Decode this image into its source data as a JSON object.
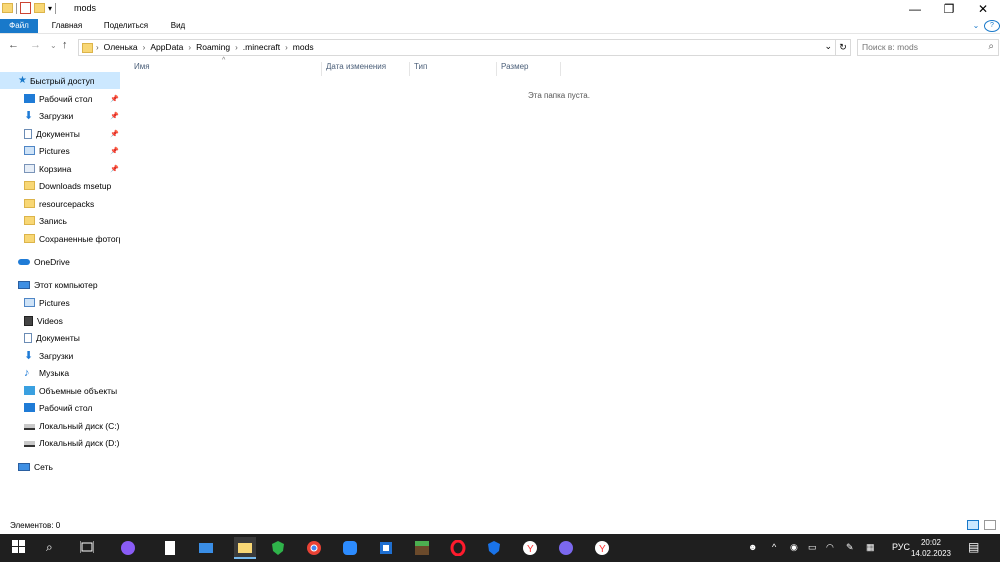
{
  "window": {
    "title": "mods",
    "controls": {
      "minimize": "—",
      "maximize": "❐",
      "close": "✕"
    }
  },
  "ribbon": {
    "tabs": [
      "Файл",
      "Главная",
      "Поделиться",
      "Вид"
    ],
    "expand_glyph": "⌄",
    "help_glyph": "?"
  },
  "nav": {
    "back": "←",
    "forward": "→",
    "recent": "⌄",
    "up": "↑"
  },
  "address": {
    "crumbs": [
      "Оленька",
      "AppData",
      "Roaming",
      ".minecraft",
      "mods"
    ],
    "dropdown": "⌄",
    "refresh": "↻"
  },
  "search": {
    "placeholder": "Поиск в: mods",
    "icon": "search-icon"
  },
  "sidebar": {
    "quick_access": "Быстрый доступ",
    "pinned": [
      {
        "label": "Рабочий стол",
        "icon": "desktop-icon",
        "pinned": true
      },
      {
        "label": "Загрузки",
        "icon": "download-icon",
        "pinned": true
      },
      {
        "label": "Документы",
        "icon": "documents-icon",
        "pinned": true
      },
      {
        "label": "Pictures",
        "icon": "pictures-icon",
        "pinned": true
      },
      {
        "label": "Корзина",
        "icon": "recycle-bin-icon",
        "pinned": true
      },
      {
        "label": "Downloads msetup",
        "icon": "folder-icon",
        "pinned": false
      },
      {
        "label": "resourcepacks",
        "icon": "folder-icon",
        "pinned": false
      },
      {
        "label": "Запись",
        "icon": "folder-icon",
        "pinned": false
      },
      {
        "label": "Сохраненные фотографии",
        "icon": "folder-icon",
        "pinned": false
      }
    ],
    "onedrive": "OneDrive",
    "this_pc": "Этот компьютер",
    "pc_items": [
      {
        "label": "Pictures",
        "icon": "pictures-icon"
      },
      {
        "label": "Videos",
        "icon": "videos-icon"
      },
      {
        "label": "Документы",
        "icon": "documents-icon"
      },
      {
        "label": "Загрузки",
        "icon": "download-icon"
      },
      {
        "label": "Музыка",
        "icon": "music-icon"
      },
      {
        "label": "Объемные объекты",
        "icon": "3d-objects-icon"
      },
      {
        "label": "Рабочий стол",
        "icon": "desktop-icon"
      },
      {
        "label": "Локальный диск (C:)",
        "icon": "drive-icon"
      },
      {
        "label": "Локальный диск (D:)",
        "icon": "drive-icon"
      }
    ],
    "network": "Сеть"
  },
  "columns": [
    "Имя",
    "Дата изменения",
    "Тип",
    "Размер"
  ],
  "empty_text": "Эта папка пуста.",
  "status": {
    "items": "Элементов: 0"
  },
  "taskbar": {
    "apps": [
      "start-icon",
      "search-icon",
      "task-view-icon",
      "alice-icon",
      "file-icon",
      "mail-icon",
      "file-explorer-icon",
      "shield-icon",
      "chrome-icon",
      "zoom-icon",
      "app-icon",
      "minecraft-icon",
      "opera-icon",
      "security-icon",
      "yandex-icon",
      "discord-icon",
      "yandex-browser-icon"
    ],
    "language": "РУС",
    "time": "20:02",
    "date": "14.02.2023"
  },
  "colors": {
    "accent": "#1979ca",
    "selected": "#cce8ff",
    "taskbar": "#1f1f1f",
    "folder": "#f8d775"
  }
}
